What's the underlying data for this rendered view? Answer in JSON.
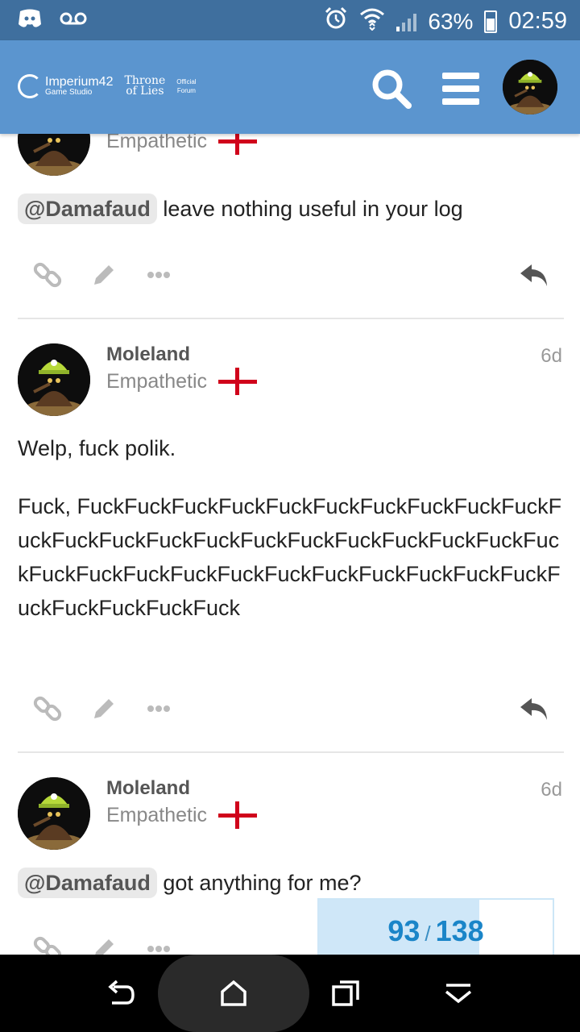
{
  "status_bar": {
    "battery": "63%",
    "time": "02:59",
    "icons": [
      "discord-icon",
      "voicemail-icon",
      "alarm-icon",
      "wifi-icon",
      "signal-icon",
      "battery-icon"
    ]
  },
  "header": {
    "studio_name": "Imperium42",
    "studio_sub": "Game Studio",
    "game_line1": "Throne",
    "game_line2": "of Lies",
    "official_line1": "Official",
    "official_line2": "Forum",
    "brand_color": "#5b95cf"
  },
  "posts": [
    {
      "user_title": "Empathetic",
      "mention": "@Damafaud",
      "text": "leave nothing useful in your log"
    },
    {
      "username": "Moleland",
      "user_title": "Empathetic",
      "age": "6d",
      "para1": "Welp, fuck polik.",
      "para2": "Fuck, FuckFuckFuckFuckFuckFuckFuckFuckFuckFuckFuckFuckFuckFuckFuckFuckFuckFuckFuckFuckFuckFuckFuckFuckFuckFuckFuckFuckFuckFuckFuckFuckFuckFuckFuckFuckFuckFuck"
    },
    {
      "username": "Moleland",
      "user_title": "Empathetic",
      "age": "6d",
      "mention": "@Damafaud",
      "text": "got anything for me?"
    }
  ],
  "progress": {
    "current": "93",
    "separator": "/",
    "total": "138",
    "fraction": 0.686
  }
}
